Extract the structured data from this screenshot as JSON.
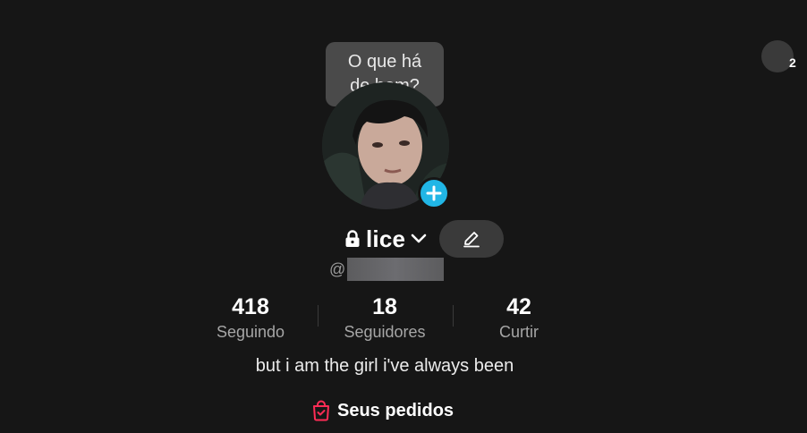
{
  "tooltip": {
    "text": "O que há de bom?"
  },
  "profile": {
    "username": "lice",
    "handle_prefix": "@",
    "bio": "but i am the girl i've always been",
    "orders_label": "Seus pedidos"
  },
  "stats": [
    {
      "value": "418",
      "label": "Seguindo"
    },
    {
      "value": "18",
      "label": "Seguidores"
    },
    {
      "value": "42",
      "label": "Curtir"
    }
  ],
  "notifications": {
    "count": "2"
  },
  "icons": {
    "lock": "lock-icon",
    "chevron": "chevron-down-icon",
    "edit": "pencil-icon",
    "add": "plus-icon",
    "orders": "shopping-bag-icon"
  },
  "colors": {
    "background": "#161616",
    "add_badge": "#21b6e6",
    "orders_icon": "#fe2c55"
  }
}
